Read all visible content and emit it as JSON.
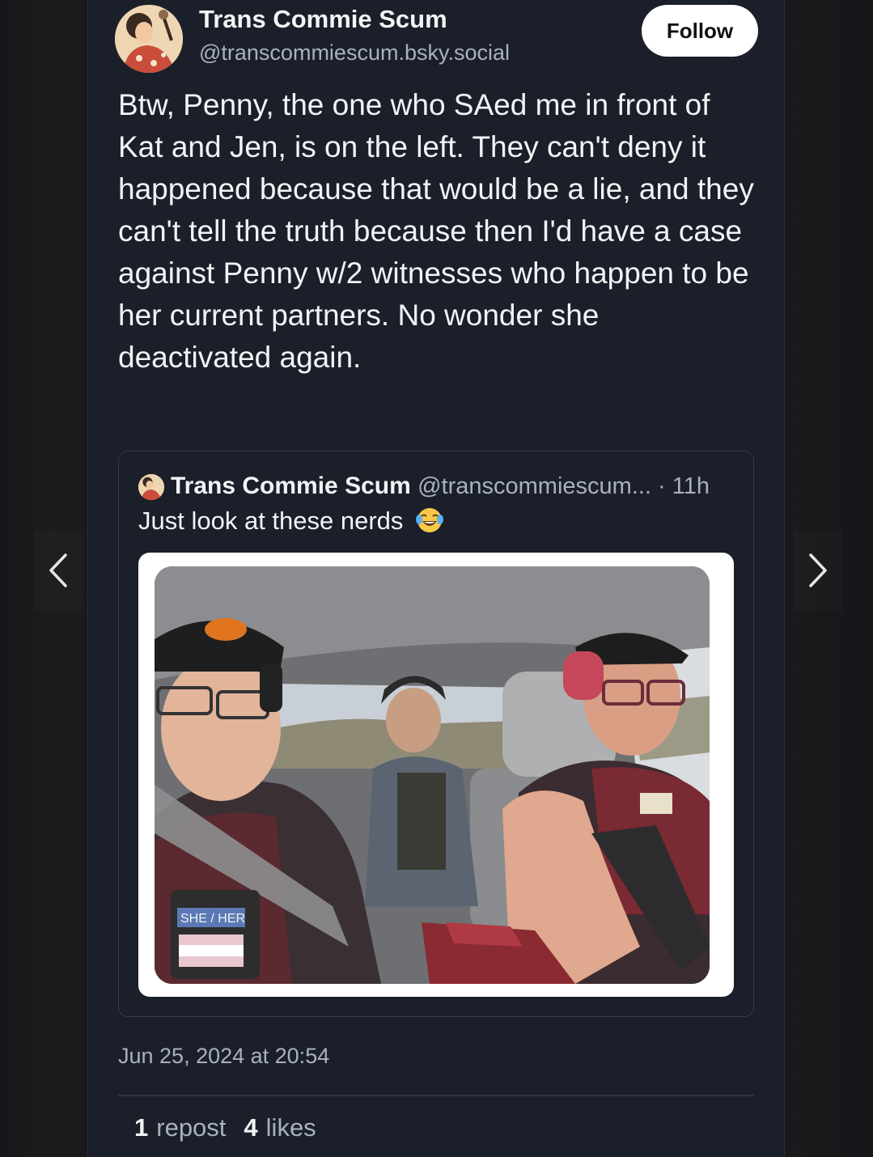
{
  "post": {
    "author_name": "Trans Commie Scum",
    "author_handle": "@transcommiescum.bsky.social",
    "follow_label": "Follow",
    "text": "Btw, Penny, the one who SAed me in front of Kat and Jen, is on the left. They can't deny it happened because that would be a lie, and they can't tell the truth because then I'd have a case against Penny w/2 witnesses who happen to be her current partners. No wonder she deactivated again.",
    "timestamp": "Jun 25, 2024 at 20:54"
  },
  "quote": {
    "author_name": "Trans Commie Scum",
    "author_handle": "@transcommiescum...",
    "separator": " · ",
    "time": "11h",
    "text": "Just look at these nerds",
    "emoji": "laughing-tears-emoji",
    "photo_patches": {
      "badge": "SHE / HER"
    }
  },
  "stats": {
    "reposts_count": "1",
    "reposts_label": "repost",
    "likes_count": "4",
    "likes_label": "likes"
  },
  "nav": {
    "prev_icon": "chevron-left-icon",
    "next_icon": "chevron-right-icon"
  },
  "colors": {
    "background": "#121418",
    "card": "#1b1f29",
    "text": "#f1f3f5",
    "muted": "#a9b1bf",
    "border": "#353b48"
  }
}
